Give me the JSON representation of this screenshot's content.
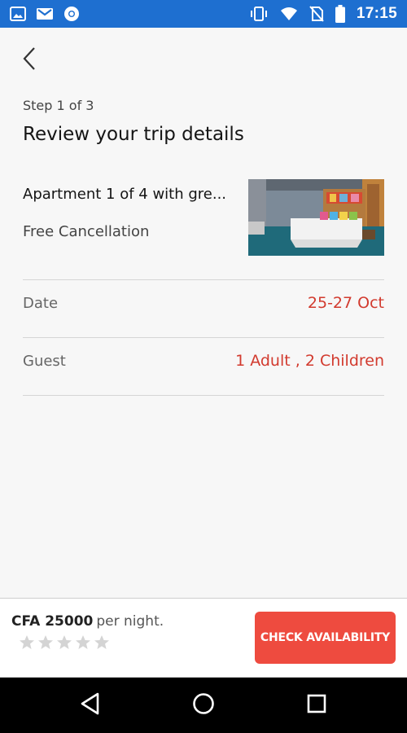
{
  "status_bar": {
    "time": "17:15",
    "left_icons": [
      "image-icon",
      "gmail-icon",
      "chrome-icon"
    ],
    "right_icons": [
      "vibrate-icon",
      "wifi-icon",
      "no-sim-icon",
      "battery-icon"
    ],
    "color": "#1e6fd0"
  },
  "header": {
    "back_icon": "chevron-left-icon",
    "step": "Step 1 of 3",
    "title": "Review your trip details"
  },
  "listing": {
    "name": "Apartment 1 of 4 with gre...",
    "cancellation": "Free Cancellation",
    "photo": "hotel-room-photo"
  },
  "details": [
    {
      "label": "Date",
      "value": "25-27 Oct"
    },
    {
      "label": "Guest",
      "value": "1 Adult , 2 Children"
    }
  ],
  "footer": {
    "price_amount": "CFA 25000",
    "price_unit": "per night.",
    "rating": 0,
    "rating_max": 5,
    "cta_label": "CHECK AVAILABILITY",
    "accent": "#ee4b3f",
    "value_color": "#d23a2e"
  },
  "nav": {
    "back": "triangle-back-icon",
    "home": "circle-home-icon",
    "recents": "square-recents-icon"
  }
}
